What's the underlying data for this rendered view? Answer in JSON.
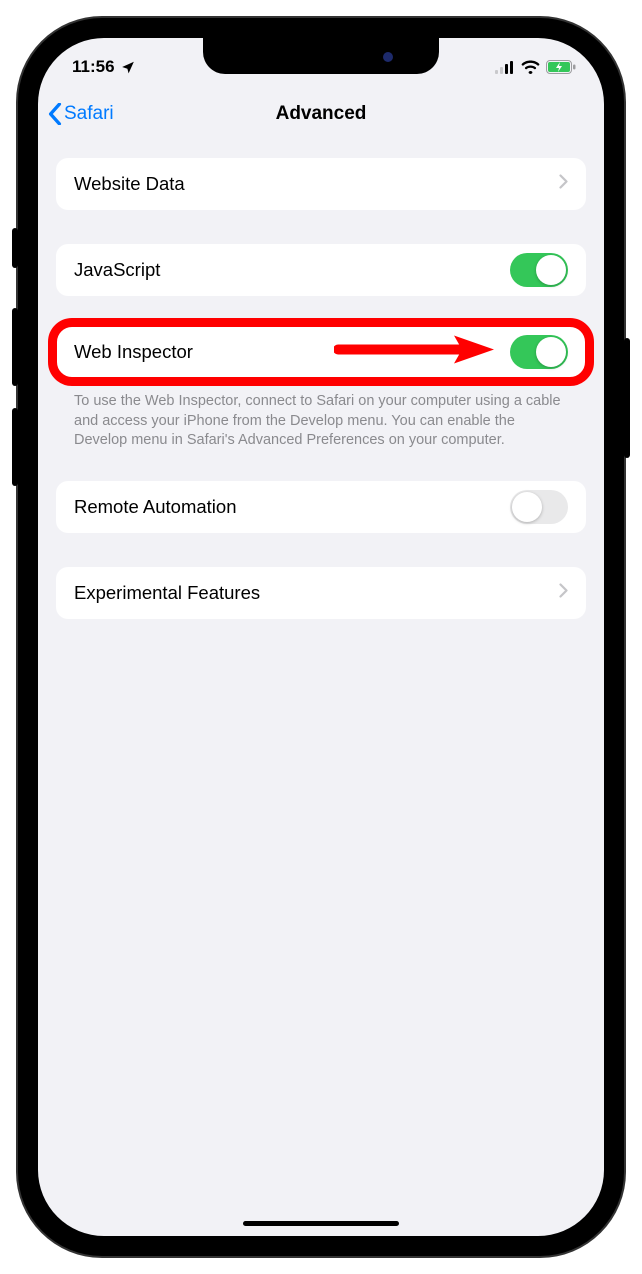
{
  "statusbar": {
    "time": "11:56"
  },
  "navbar": {
    "back_label": "Safari",
    "title": "Advanced"
  },
  "rows": {
    "website_data": "Website Data",
    "javascript": "JavaScript",
    "web_inspector": "Web Inspector",
    "web_inspector_footer": "To use the Web Inspector, connect to Safari on your computer using a cable and access your iPhone from the Develop menu. You can enable the Develop menu in Safari's Advanced Preferences on your computer.",
    "remote_automation": "Remote Automation",
    "experimental_features": "Experimental Features"
  },
  "toggles": {
    "javascript": true,
    "web_inspector": true,
    "remote_automation": false
  },
  "colors": {
    "accent": "#007aff",
    "toggle_on": "#34c759",
    "annotation": "#ff0000"
  }
}
